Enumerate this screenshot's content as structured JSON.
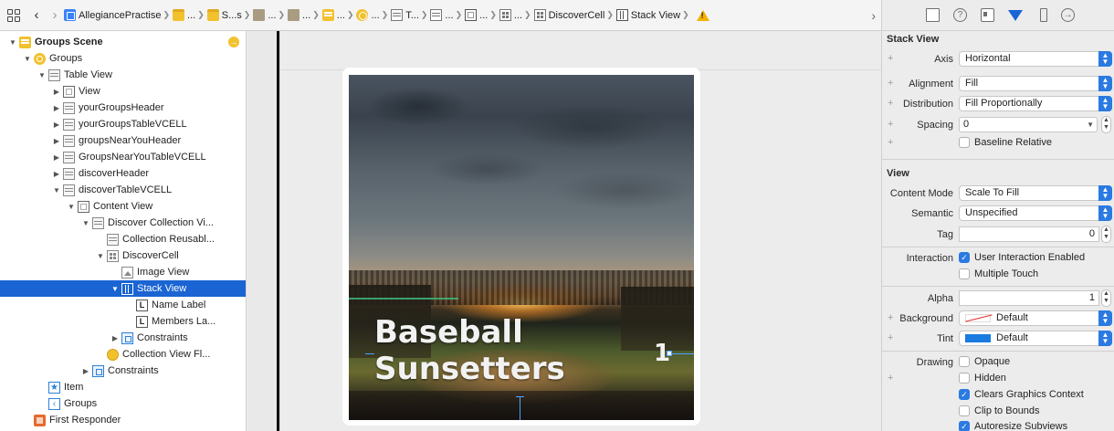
{
  "breadcrumb": {
    "items": [
      {
        "label": "AllegiancePractise",
        "icon": "file"
      },
      {
        "label": "...",
        "icon": "folder"
      },
      {
        "label": "S...s",
        "icon": "folder"
      },
      {
        "label": "...",
        "icon": "doc"
      },
      {
        "label": "...",
        "icon": "doc"
      },
      {
        "label": "...",
        "icon": "scene"
      },
      {
        "label": "...",
        "icon": "ctrl"
      },
      {
        "label": "T...",
        "icon": "table"
      },
      {
        "label": "...",
        "icon": "table"
      },
      {
        "label": "...",
        "icon": "view"
      },
      {
        "label": "...",
        "icon": "cell"
      },
      {
        "label": "DiscoverCell",
        "icon": "cell"
      },
      {
        "label": "Stack View",
        "icon": "stack"
      }
    ]
  },
  "outline": {
    "rows": [
      {
        "label": "Groups Scene",
        "icon": "scene",
        "disclosure": "▼",
        "bold": true
      },
      {
        "label": "Groups",
        "icon": "vc",
        "disclosure": "▼"
      },
      {
        "label": "Table View",
        "icon": "table",
        "disclosure": "▼"
      },
      {
        "label": "View",
        "icon": "view",
        "disclosure": "▶"
      },
      {
        "label": "yourGroupsHeader",
        "icon": "table",
        "disclosure": "▶"
      },
      {
        "label": "yourGroupsTableVCELL",
        "icon": "table",
        "disclosure": "▶"
      },
      {
        "label": "groupsNearYouHeader",
        "icon": "table",
        "disclosure": "▶"
      },
      {
        "label": "GroupsNearYouTableVCELL",
        "icon": "table",
        "disclosure": "▶"
      },
      {
        "label": "discoverHeader",
        "icon": "table",
        "disclosure": "▶"
      },
      {
        "label": "discoverTableVCELL",
        "icon": "table",
        "disclosure": "▼"
      },
      {
        "label": "Content View",
        "icon": "view",
        "disclosure": "▼"
      },
      {
        "label": "Discover Collection Vi...",
        "icon": "table",
        "disclosure": "▼"
      },
      {
        "label": "Collection Reusabl...",
        "icon": "table",
        "disclosure": ""
      },
      {
        "label": "DiscoverCell",
        "icon": "cell",
        "disclosure": "▼"
      },
      {
        "label": "Image View",
        "icon": "image",
        "disclosure": ""
      },
      {
        "label": "Stack View",
        "icon": "stack",
        "disclosure": "▼",
        "selected": true
      },
      {
        "label": "Name Label",
        "icon": "label",
        "disclosure": ""
      },
      {
        "label": "Members La...",
        "icon": "label",
        "disclosure": ""
      },
      {
        "label": "Constraints",
        "icon": "constraint",
        "disclosure": "▶"
      },
      {
        "label": "Collection View Fl...",
        "icon": "layout",
        "disclosure": ""
      },
      {
        "label": "Constraints",
        "icon": "constraint",
        "disclosure": "▶"
      },
      {
        "label": "Item",
        "icon": "star",
        "disclosure": ""
      },
      {
        "label": "Groups",
        "icon": "back",
        "disclosure": ""
      },
      {
        "label": "First Responder",
        "icon": "responder",
        "disclosure": ""
      }
    ]
  },
  "canvas": {
    "name_label": "Baseball Sunsetters",
    "members_label": "1"
  },
  "inspector": {
    "stack_view": {
      "title": "Stack View",
      "axis_label": "Axis",
      "axis_value": "Horizontal",
      "alignment_label": "Alignment",
      "alignment_value": "Fill",
      "distribution_label": "Distribution",
      "distribution_value": "Fill Proportionally",
      "spacing_label": "Spacing",
      "spacing_value": "0",
      "baseline_label": "Baseline Relative",
      "baseline_checked": false
    },
    "view": {
      "title": "View",
      "content_mode_label": "Content Mode",
      "content_mode_value": "Scale To Fill",
      "semantic_label": "Semantic",
      "semantic_value": "Unspecified",
      "tag_label": "Tag",
      "tag_value": "0",
      "interaction_label": "Interaction",
      "user_interaction_label": "User Interaction Enabled",
      "user_interaction_checked": true,
      "multiple_touch_label": "Multiple Touch",
      "multiple_touch_checked": false,
      "alpha_label": "Alpha",
      "alpha_value": "1",
      "background_label": "Background",
      "background_value": "Default",
      "tint_label": "Tint",
      "tint_value": "Default",
      "tint_color": "#1a7be0",
      "drawing_label": "Drawing",
      "opaque_label": "Opaque",
      "opaque_checked": false,
      "hidden_label": "Hidden",
      "hidden_checked": false,
      "clears_label": "Clears Graphics Context",
      "clears_checked": true,
      "clip_label": "Clip to Bounds",
      "clip_checked": false,
      "autoresize_label": "Autoresize Subviews",
      "autoresize_checked": true
    }
  },
  "colors": {
    "accent": "#1a64d3",
    "warning": "#f2b200"
  }
}
